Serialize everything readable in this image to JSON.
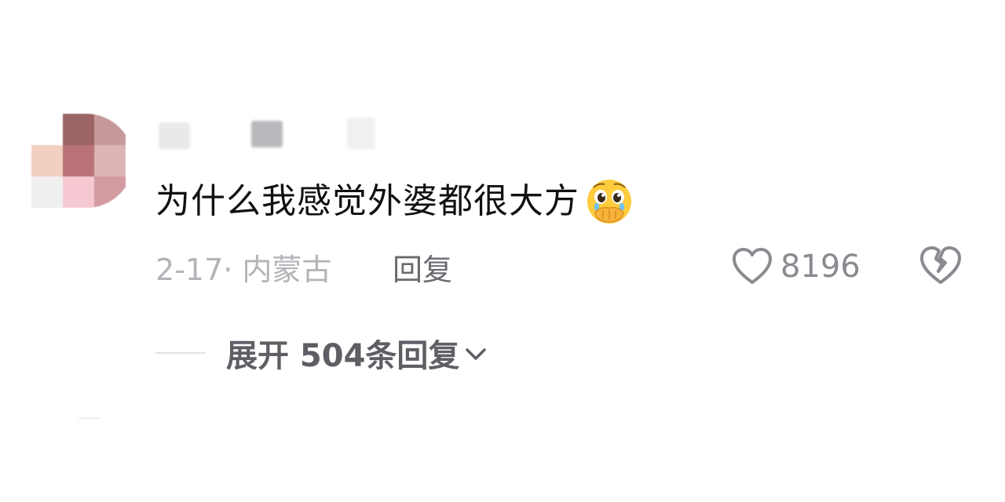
{
  "comment": {
    "text": "为什么我感觉外婆都很大方",
    "emoji": "face-holding-back-tears-emoji",
    "meta": "2-17· 内蒙古",
    "reply_label": "回复",
    "like_count": "8196",
    "expand_label": "展开 504条回复"
  },
  "icons": {
    "like": "heart-outline-icon",
    "dislike": "broken-heart-icon",
    "expand": "chevron-down-icon"
  },
  "colors": {
    "text_primary": "#111111",
    "text_meta": "#b3b3b8",
    "text_action": "#6a6a70",
    "icon_gray": "#8a8a90",
    "background": "#ffffff"
  }
}
